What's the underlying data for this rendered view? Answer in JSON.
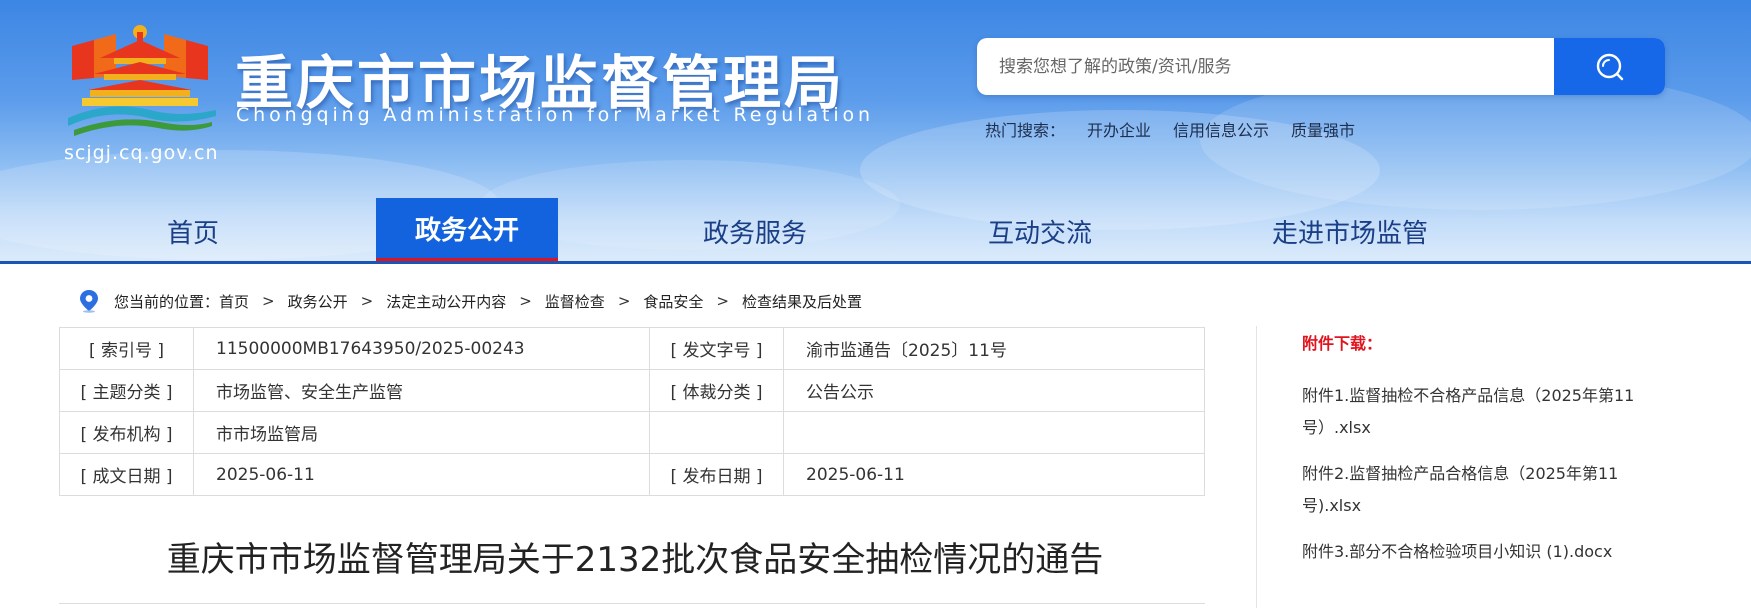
{
  "header": {
    "title": "重庆市市场监督管理局",
    "subtitle": "Chongqing  Administration for Market Regulation",
    "domain": "scjgj.cq.gov.cn",
    "search": {
      "placeholder": "搜索您想了解的政策/资讯/服务"
    },
    "hot_label": "热门搜索：",
    "hot_items": [
      "开办企业",
      "信用信息公示",
      "质量强市"
    ]
  },
  "nav": {
    "items": [
      "首页",
      "政务公开",
      "政务服务",
      "互动交流",
      "走进市场监管"
    ],
    "active": "政务公开"
  },
  "breadcrumb": {
    "prefix": "您当前的位置：",
    "items": [
      "首页",
      "政务公开",
      "法定主动公开内容",
      "监督检查",
      "食品安全",
      "检查结果及后处置"
    ],
    "separator": ">"
  },
  "meta": {
    "rows": [
      [
        "[ 索引号 ]",
        "11500000MB17643950/2025-00243",
        "[ 发文字号 ]",
        "渝市监通告〔2025〕11号"
      ],
      [
        "[ 主题分类 ]",
        "市场监管、安全生产监管",
        "[ 体裁分类 ]",
        "公告公示"
      ],
      [
        "[ 发布机构 ]",
        "市市场监管局",
        "",
        ""
      ],
      [
        "[ 成文日期 ]",
        "2025-06-11",
        "[ 发布日期 ]",
        "2025-06-11"
      ]
    ]
  },
  "document": {
    "title": "重庆市市场监督管理局关于2132批次食品安全抽检情况的通告"
  },
  "sidebar": {
    "title": "附件下载：",
    "attachments": [
      "附件1.监督抽检不合格产品信息（2025年第11号）.xlsx",
      "附件2.监督抽检产品合格信息（2025年第11号).xlsx",
      "附件3.部分不合格检验项目小知识 (1).docx"
    ]
  },
  "colors": {
    "primary": "#1463de",
    "accent_red": "#e0141e",
    "nav_text": "#1a3f86"
  },
  "icons": [
    "location-pin-icon",
    "search-icon",
    "emblem-logo"
  ]
}
